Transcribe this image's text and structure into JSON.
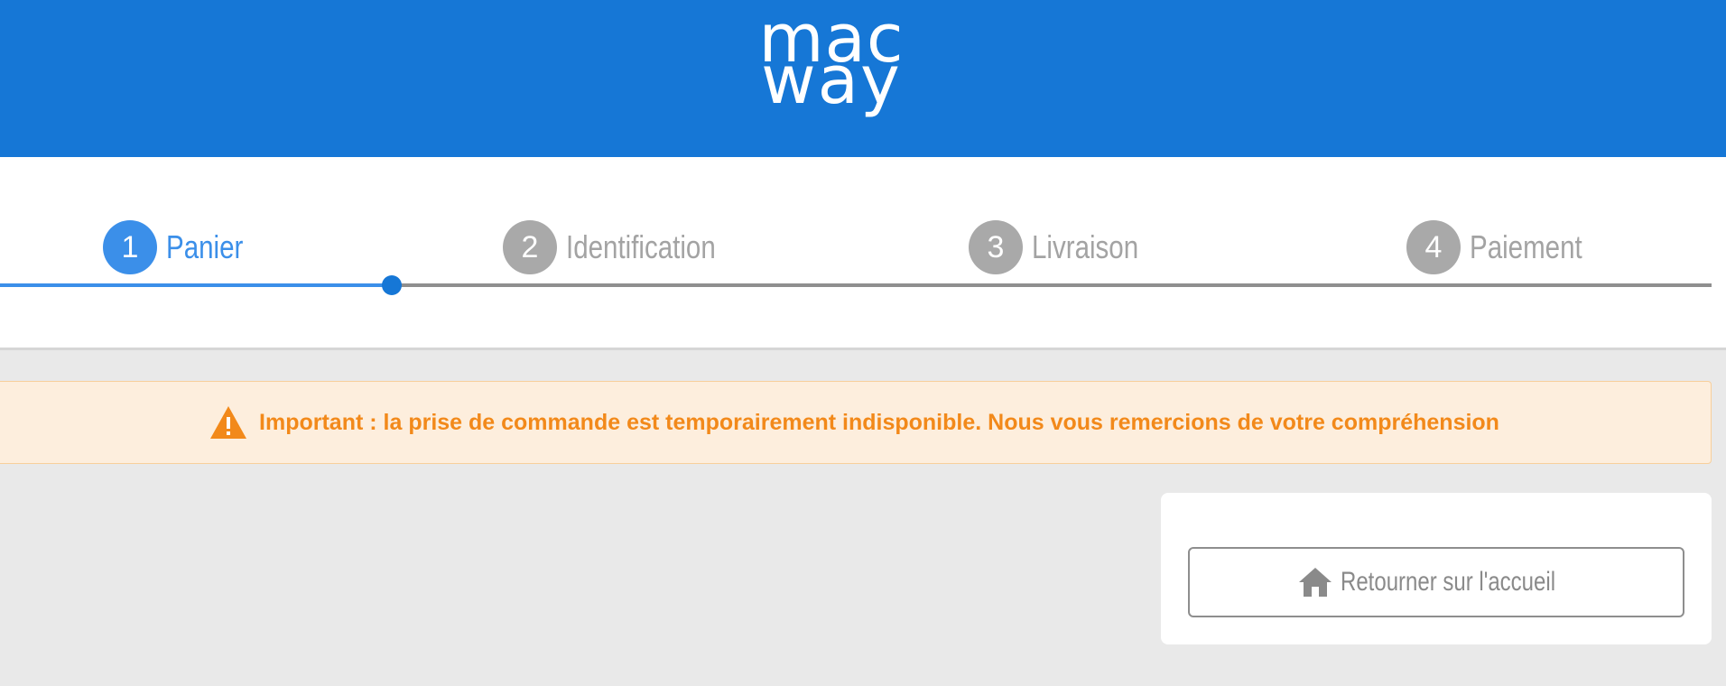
{
  "header": {
    "logo_line1": "mac",
    "logo_line2": "way",
    "background": "#1677d6"
  },
  "steps": [
    {
      "number": "1",
      "label": "Panier",
      "active": true
    },
    {
      "number": "2",
      "label": "Identification",
      "active": false
    },
    {
      "number": "3",
      "label": "Livraison",
      "active": false
    },
    {
      "number": "4",
      "label": "Paiement",
      "active": false
    }
  ],
  "progress": {
    "completed_steps": 1,
    "total_steps": 4
  },
  "alert": {
    "icon": "warning-triangle-icon",
    "message": "Important : la prise de commande est temporairement indisponible. Nous vous remercions de votre compréhension",
    "color": "#f2891a",
    "background": "#fdeedd"
  },
  "actions": {
    "home_icon": "home-icon",
    "home_label": "Retourner sur l'accueil"
  },
  "colors": {
    "accent": "#3b8fe9",
    "inactive": "#a9a9a9"
  }
}
